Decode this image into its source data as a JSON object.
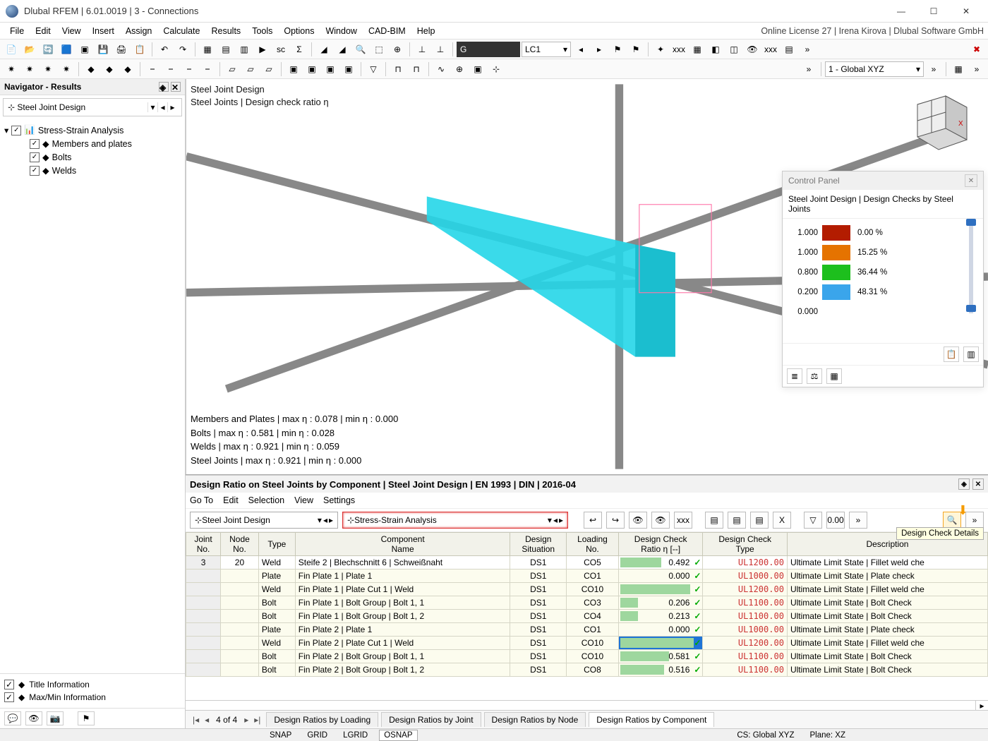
{
  "window": {
    "title": "Dlubal RFEM | 6.01.0019 | 3 - Connections",
    "license": "Online License 27 | Irena Kirova | Dlubal Software GmbH"
  },
  "menubar": [
    "File",
    "Edit",
    "View",
    "Insert",
    "Assign",
    "Calculate",
    "Results",
    "Tools",
    "Options",
    "Window",
    "CAD-BIM",
    "Help"
  ],
  "toolbar2": {
    "load_combo_g": "G",
    "load_combo_lc": "LC1",
    "coord_combo": "1 - Global XYZ"
  },
  "navigator": {
    "title": "Navigator - Results",
    "selector": "Steel Joint Design",
    "root": "Stress-Strain Analysis",
    "children": [
      "Members and plates",
      "Bolts",
      "Welds"
    ],
    "footer": [
      "Title Information",
      "Max/Min Information"
    ]
  },
  "viewport": {
    "overlay": [
      "Steel Joint Design",
      "Steel Joints | Design check ratio η"
    ],
    "stats": [
      "Members and Plates | max η : 0.078 | min η : 0.000",
      "Bolts | max η : 0.581 | min η : 0.028",
      "Welds | max η : 0.921 | min η : 0.059",
      "Steel Joints | max η : 0.921 | min η : 0.000"
    ]
  },
  "control_panel": {
    "title": "Control Panel",
    "subtitle": "Steel Joint Design | Design Checks by Steel Joints",
    "legend": [
      {
        "v": "1.000",
        "c": "#b31c00",
        "p": "0.00 %"
      },
      {
        "v": "1.000",
        "c": "#e57300",
        "p": "15.25 %"
      },
      {
        "v": "0.800",
        "c": "#1dbf1d",
        "p": "36.44 %"
      },
      {
        "v": "0.200",
        "c": "#3aa5eb",
        "p": "48.31 %"
      },
      {
        "v": "0.000",
        "c": "",
        "p": ""
      }
    ]
  },
  "bottom": {
    "title": "Design Ratio on Steel Joints by Component | Steel Joint Design | EN 1993 | DIN | 2016-04",
    "menu": [
      "Go To",
      "Edit",
      "Selection",
      "View",
      "Settings"
    ],
    "combo1": "Steel Joint Design",
    "combo2": "Stress-Strain Analysis",
    "tooltip": "Design Check Details",
    "headers": [
      "Joint\nNo.",
      "Node\nNo.",
      "Type",
      "Component\nName",
      "Design\nSituation",
      "Loading\nNo.",
      "Design Check\nRatio η [--]",
      "Design Check\nType",
      "Description"
    ],
    "rows": [
      {
        "j": "3",
        "n": "20",
        "t": "Weld",
        "c": "Steife 2 | Blechschnitt 6 | Schweißnaht",
        "ds": "DS1",
        "ld": "CO5",
        "r": 0.492,
        "dt": "UL1200.00",
        "desc": "Ultimate Limit State | Fillet weld che"
      },
      {
        "j": "",
        "n": "",
        "t": "Plate",
        "c": "Fin Plate 1 | Plate 1",
        "ds": "DS1",
        "ld": "CO1",
        "r": 0.0,
        "dt": "UL1000.00",
        "desc": "Ultimate Limit State | Plate check"
      },
      {
        "j": "",
        "n": "",
        "t": "Weld",
        "c": "Fin Plate 1 | Plate Cut 1 | Weld",
        "ds": "DS1",
        "ld": "CO10",
        "r": 0.844,
        "dt": "UL1200.00",
        "desc": "Ultimate Limit State | Fillet weld che"
      },
      {
        "j": "",
        "n": "",
        "t": "Bolt",
        "c": "Fin Plate 1 | Bolt Group | Bolt 1, 1",
        "ds": "DS1",
        "ld": "CO3",
        "r": 0.206,
        "dt": "UL1100.00",
        "desc": "Ultimate Limit State | Bolt Check"
      },
      {
        "j": "",
        "n": "",
        "t": "Bolt",
        "c": "Fin Plate 1 | Bolt Group | Bolt 1, 2",
        "ds": "DS1",
        "ld": "CO4",
        "r": 0.213,
        "dt": "UL1100.00",
        "desc": "Ultimate Limit State | Bolt Check"
      },
      {
        "j": "",
        "n": "",
        "t": "Plate",
        "c": "Fin Plate 2 | Plate 1",
        "ds": "DS1",
        "ld": "CO1",
        "r": 0.0,
        "dt": "UL1000.00",
        "desc": "Ultimate Limit State | Plate check"
      },
      {
        "j": "",
        "n": "",
        "t": "Weld",
        "c": "Fin Plate 2 | Plate Cut 1 | Weld",
        "ds": "DS1",
        "ld": "CO10",
        "r": 0.884,
        "dt": "UL1200.00",
        "desc": "Ultimate Limit State | Fillet weld che",
        "hl": true
      },
      {
        "j": "",
        "n": "",
        "t": "Bolt",
        "c": "Fin Plate 2 | Bolt Group | Bolt 1, 1",
        "ds": "DS1",
        "ld": "CO10",
        "r": 0.581,
        "dt": "UL1100.00",
        "desc": "Ultimate Limit State | Bolt Check"
      },
      {
        "j": "",
        "n": "",
        "t": "Bolt",
        "c": "Fin Plate 2 | Bolt Group | Bolt 1, 2",
        "ds": "DS1",
        "ld": "CO8",
        "r": 0.516,
        "dt": "UL1100.00",
        "desc": "Ultimate Limit State | Bolt Check"
      }
    ],
    "pager": "4 of 4",
    "tabs": [
      "Design Ratios by Loading",
      "Design Ratios by Joint",
      "Design Ratios by Node",
      "Design Ratios by Component"
    ],
    "active_tab": 3
  },
  "statusbar": {
    "snap": "SNAP",
    "grid": "GRID",
    "lgrid": "LGRID",
    "osnap": "OSNAP",
    "cs": "CS: Global XYZ",
    "plane": "Plane: XZ"
  }
}
